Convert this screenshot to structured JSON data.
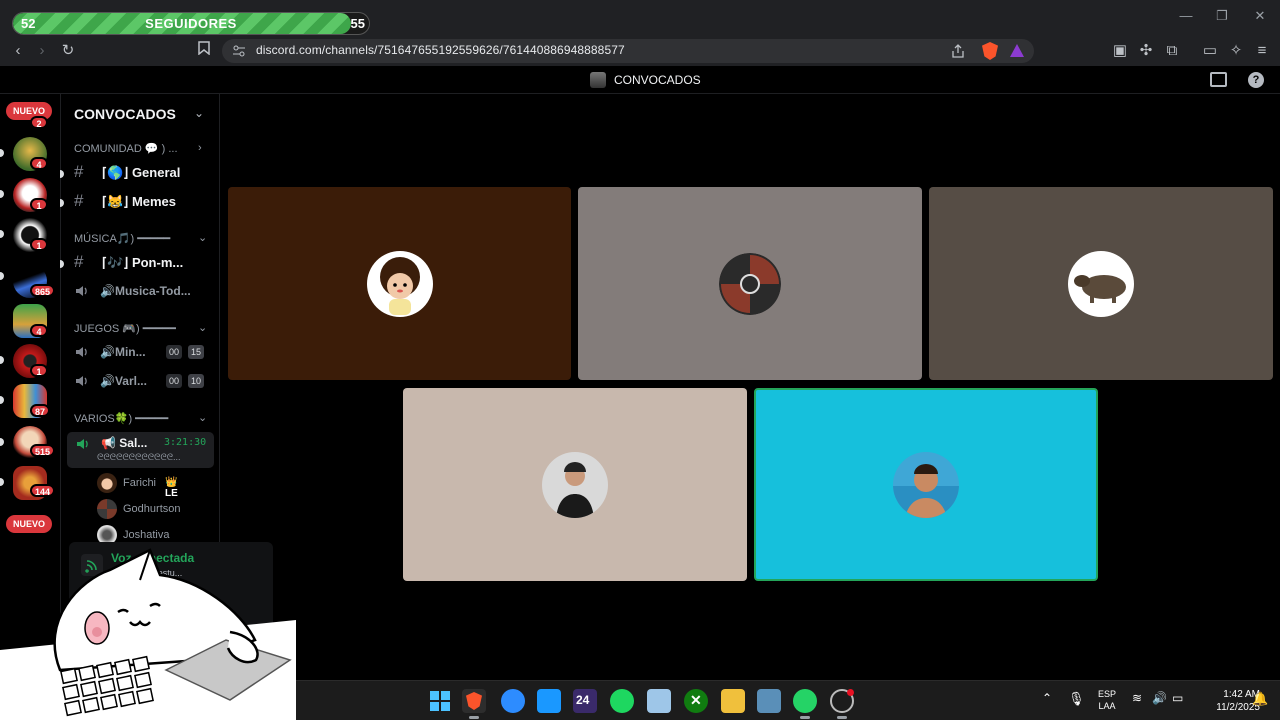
{
  "progress": {
    "left_value": "52",
    "title": "SEGUIDORES",
    "right_value": "55",
    "fill_fraction": 0.95
  },
  "browser": {
    "url": "discord.com/channels/751647655192559626/761440886948888577"
  },
  "header": {
    "title": "CONVOCADOS"
  },
  "rail": {
    "nuevo_top": "NUEVO",
    "nuevo_bottom": "NUEVO",
    "badges": [
      "2",
      "4",
      "1",
      "1",
      "865",
      "4",
      "1",
      "87",
      "515",
      "144"
    ]
  },
  "sidebar": {
    "guild_name": "CONVOCADOS",
    "categories": {
      "comunidad": "COMUNIDAD 💬 ) ...",
      "musica": "MÚSICA🎵) ━━━━━",
      "juegos": "JUEGOS 🎮) ━━━━━",
      "varios": "VARIOS🍀) ━━━━━"
    },
    "channels": {
      "general": "⌈🌎⌋ General",
      "memes": "⌈😹⌋ Memes",
      "pon": "⌈🎶⌋ Pon-m...",
      "musica_todo": "🔊Musica-Tod...",
      "minecraft": "🔊Min...",
      "minecraft_counts": [
        "00",
        "15"
      ],
      "varios": "🔊Varl...",
      "varios_counts": [
        "00",
        "10"
      ],
      "sala": "📢 Sal...",
      "sala_time": "3:21:30",
      "sala_sub": "ᘓᘓᘓᘓᘓᘓᘓᘓᘓᘓᘓᘓ..."
    },
    "members": [
      {
        "name": "Farichi",
        "tag": "👑LE"
      },
      {
        "name": "Godhurtson",
        "tag": ""
      },
      {
        "name": "Joshativa",
        "tag": ""
      }
    ],
    "voice": {
      "title": "Voz conectada",
      "subtitle": "📢 Sala de estu..."
    }
  },
  "tiles": [
    {
      "name": "tile-1",
      "bg": "#3b1c08"
    },
    {
      "name": "tile-2",
      "bg": "#837c7a"
    },
    {
      "name": "tile-3",
      "bg": "#564d45"
    },
    {
      "name": "tile-4",
      "bg": "#c8b8ad"
    },
    {
      "name": "tile-5",
      "bg": "#16c0dc",
      "speaking": true
    }
  ],
  "taskbar": {
    "lang_top": "ESP",
    "lang_bottom": "LAA",
    "time": "1:42 AM",
    "date": "11/2/2025"
  },
  "colors": {
    "speaking_border": "#23a55a",
    "badge_red": "#da373c",
    "accent_green": "#23a55a"
  }
}
